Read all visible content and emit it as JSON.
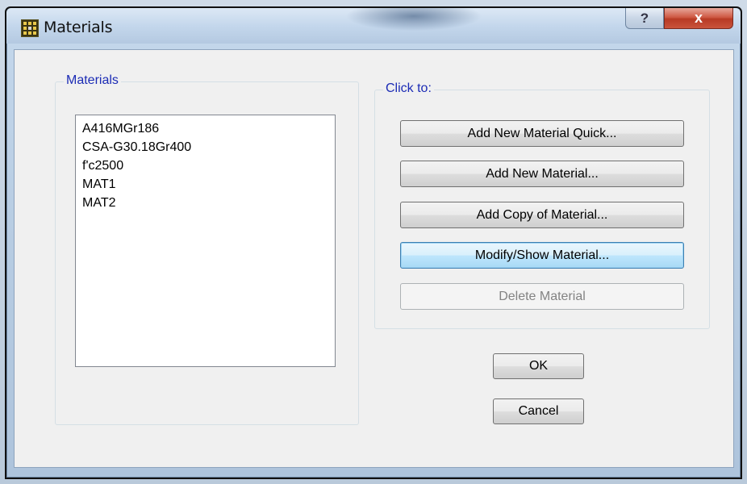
{
  "window": {
    "title": "Materials",
    "help_glyph": "?",
    "close_glyph": "x"
  },
  "materials_group": {
    "label": "Materials",
    "items": [
      "A416MGr186",
      "CSA-G30.18Gr400",
      "f'c2500",
      "MAT1",
      "MAT2"
    ]
  },
  "click_group": {
    "label": "Click to:",
    "buttons": {
      "add_quick": "Add New Material Quick...",
      "add_new": "Add New Material...",
      "add_copy": "Add Copy of Material...",
      "modify": "Modify/Show Material...",
      "delete": "Delete Material"
    }
  },
  "dialog_buttons": {
    "ok": "OK",
    "cancel": "Cancel"
  },
  "icons": {
    "app": "grid-app-icon",
    "help": "help-icon",
    "close": "close-icon"
  },
  "colors": {
    "group_label": "#1b2bb5",
    "close_button": "#c9533b",
    "focused_button": "#3c7fb1"
  }
}
